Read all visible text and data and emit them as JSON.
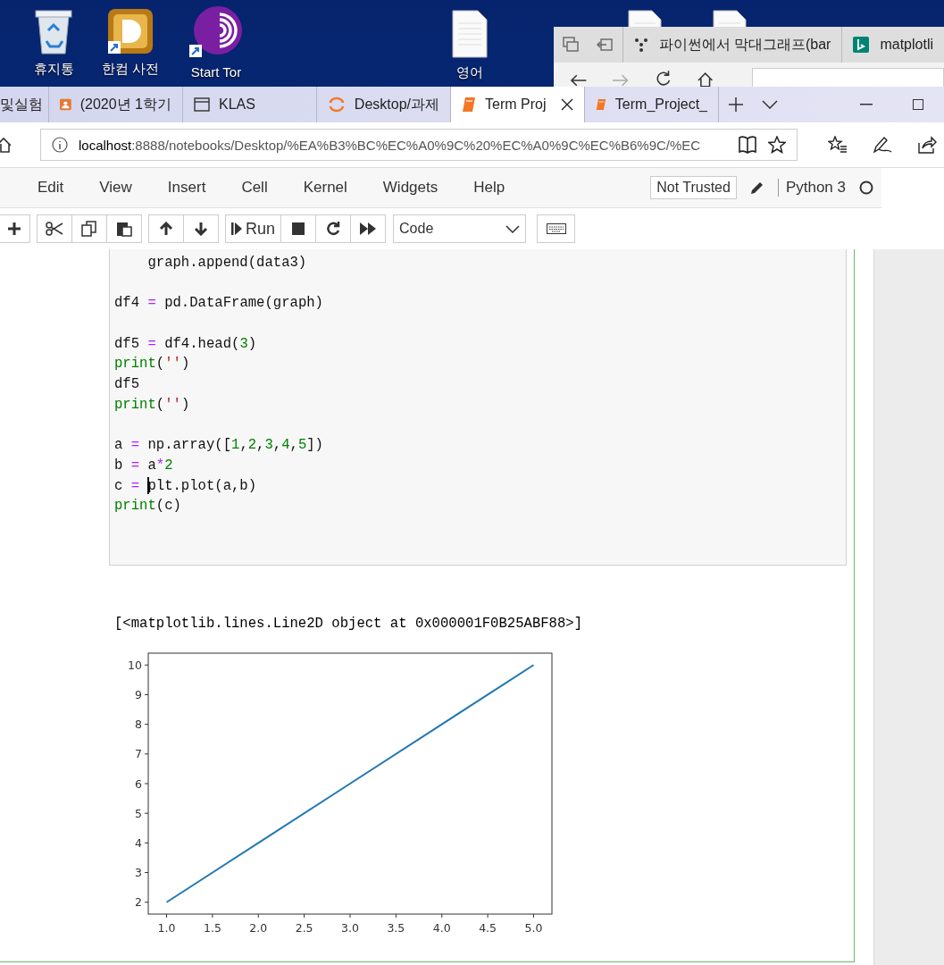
{
  "desktop": {
    "icons": [
      {
        "kind": "recycle",
        "label": "휴지통"
      },
      {
        "kind": "hancom",
        "label": "한컴 사전"
      },
      {
        "kind": "tor",
        "label": "Start Tor"
      },
      {
        "kind": "doc",
        "label": "영어"
      },
      {
        "kind": "doc-small"
      },
      {
        "kind": "doc-small"
      }
    ]
  },
  "back_window": {
    "tabs": [
      {
        "kind": "dots",
        "label": "파이썬에서 막대그래프(bar"
      },
      {
        "kind": "bing",
        "label": "matplotli"
      }
    ]
  },
  "browser": {
    "tabs": [
      {
        "kind": "none",
        "label": "및실험",
        "selected": false
      },
      {
        "kind": "person",
        "label": "(2020년 1학기",
        "selected": false
      },
      {
        "kind": "window",
        "label": "KLAS",
        "selected": false
      },
      {
        "kind": "jupyter",
        "label": "Desktop/과제",
        "selected": false
      },
      {
        "kind": "book",
        "label": "Term Proj",
        "selected": true
      },
      {
        "kind": "book",
        "label": "Term_Project_",
        "selected": false
      }
    ],
    "address_host": "localhost",
    "address_path": ":8888/notebooks/Desktop/%EA%B3%BC%EC%A0%9C%20%EC%A0%9C%EC%B6%9C/%EC"
  },
  "notebook": {
    "menu": [
      "Edit",
      "View",
      "Insert",
      "Cell",
      "Kernel",
      "Widgets",
      "Help"
    ],
    "trust_button": "Not Trusted",
    "kernel": "Python 3",
    "toolbar": {
      "run": "Run",
      "cell_type": "Code"
    },
    "code_lines": [
      {
        "blank_before": false,
        "tokens": [
          {
            "kind": "plain",
            "text": "    graph.append(data3)"
          }
        ]
      },
      {
        "blank_before": true,
        "tokens": [
          {
            "kind": "plain",
            "text": "df4"
          },
          {
            "kind": "op",
            "text": " = "
          },
          {
            "kind": "plain",
            "text": "pd.DataFrame(graph)"
          }
        ]
      },
      {
        "blank_before": true,
        "tokens": [
          {
            "kind": "plain",
            "text": "df5"
          },
          {
            "kind": "op",
            "text": " = "
          },
          {
            "kind": "plain",
            "text": "df4.head("
          },
          {
            "kind": "num",
            "text": "3"
          },
          {
            "kind": "plain",
            "text": ")"
          }
        ]
      },
      {
        "blank_before": false,
        "tokens": [
          {
            "kind": "kw",
            "text": "print"
          },
          {
            "kind": "plain",
            "text": "("
          },
          {
            "kind": "str",
            "text": "''"
          },
          {
            "kind": "plain",
            "text": ")"
          }
        ]
      },
      {
        "blank_before": false,
        "tokens": [
          {
            "kind": "plain",
            "text": "df5"
          }
        ]
      },
      {
        "blank_before": false,
        "tokens": [
          {
            "kind": "kw",
            "text": "print"
          },
          {
            "kind": "plain",
            "text": "("
          },
          {
            "kind": "str",
            "text": "''"
          },
          {
            "kind": "plain",
            "text": ")"
          }
        ]
      },
      {
        "blank_before": true,
        "tokens": [
          {
            "kind": "plain",
            "text": "a"
          },
          {
            "kind": "op",
            "text": " = "
          },
          {
            "kind": "plain",
            "text": "np.array(["
          },
          {
            "kind": "num",
            "text": "1"
          },
          {
            "kind": "plain",
            "text": ","
          },
          {
            "kind": "num",
            "text": "2"
          },
          {
            "kind": "plain",
            "text": ","
          },
          {
            "kind": "num",
            "text": "3"
          },
          {
            "kind": "plain",
            "text": ","
          },
          {
            "kind": "num",
            "text": "4"
          },
          {
            "kind": "plain",
            "text": ","
          },
          {
            "kind": "num",
            "text": "5"
          },
          {
            "kind": "plain",
            "text": "])"
          }
        ]
      },
      {
        "blank_before": false,
        "tokens": [
          {
            "kind": "plain",
            "text": "b"
          },
          {
            "kind": "op",
            "text": " = "
          },
          {
            "kind": "plain",
            "text": "a"
          },
          {
            "kind": "op",
            "text": "*"
          },
          {
            "kind": "num",
            "text": "2"
          }
        ]
      },
      {
        "blank_before": false,
        "tokens": [
          {
            "kind": "plain",
            "text": "c"
          },
          {
            "kind": "op",
            "text": " = "
          },
          {
            "kind": "plain",
            "text": "plt.plot(a,b)",
            "cursor": true
          }
        ]
      },
      {
        "blank_before": false,
        "tokens": [
          {
            "kind": "kw",
            "text": "print"
          },
          {
            "kind": "plain",
            "text": "(c)"
          }
        ]
      }
    ],
    "output": "[<matplotlib.lines.Line2D object at 0x000001F0B25ABF88>]",
    "chart_data": {
      "type": "line",
      "x": [
        1,
        2,
        3,
        4,
        5
      ],
      "series": [
        {
          "color": "#1f77b4",
          "values": [
            2,
            4,
            6,
            8,
            10
          ]
        }
      ],
      "xlim": [
        0.8,
        5.2
      ],
      "ylim": [
        1.6,
        10.4
      ],
      "xticks": [
        {
          "value": 1,
          "label": "1.0"
        },
        {
          "value": 1.5,
          "label": "1.5"
        },
        {
          "value": 2,
          "label": "2.0"
        },
        {
          "value": 2.5,
          "label": "2.5"
        },
        {
          "value": 3,
          "label": "3.0"
        },
        {
          "value": 3.5,
          "label": "3.5"
        },
        {
          "value": 4,
          "label": "4.0"
        },
        {
          "value": 4.5,
          "label": "4.5"
        },
        {
          "value": 5,
          "label": "5.0"
        }
      ],
      "yticks": [
        {
          "value": 2,
          "label": "2"
        },
        {
          "value": 3,
          "label": "3"
        },
        {
          "value": 4,
          "label": "4"
        },
        {
          "value": 5,
          "label": "5"
        },
        {
          "value": 6,
          "label": "6"
        },
        {
          "value": 7,
          "label": "7"
        },
        {
          "value": 8,
          "label": "8"
        },
        {
          "value": 9,
          "label": "9"
        },
        {
          "value": 10,
          "label": "10"
        }
      ]
    }
  }
}
